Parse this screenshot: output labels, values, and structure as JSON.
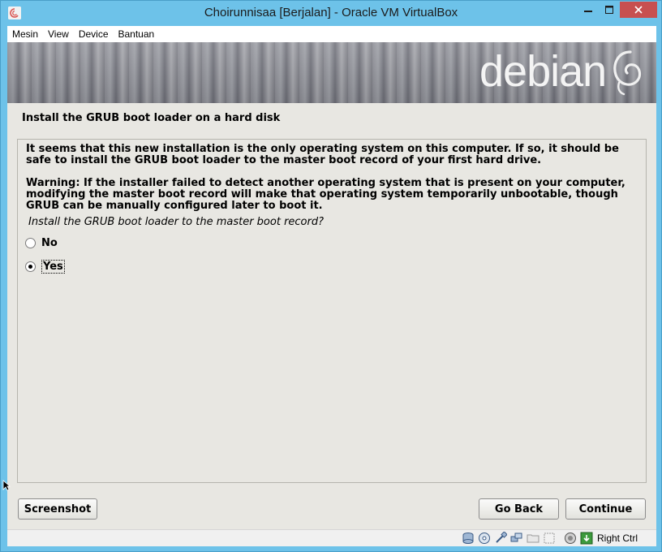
{
  "window": {
    "title": "Choirunnisaa [Berjalan] - Oracle VM VirtualBox",
    "minimize_glyph": "—",
    "maximize_glyph": "☐",
    "close_glyph": "✕"
  },
  "menu": {
    "items": [
      "Mesin",
      "View",
      "Device",
      "Bantuan"
    ]
  },
  "installer": {
    "banner_logo": "debian",
    "heading": "Install the GRUB boot loader on a hard disk",
    "paragraph1": "It seems that this new installation is the only operating system on this computer. If so, it should be safe to install the GRUB boot loader to the master boot record of your first hard drive.",
    "paragraph2": "Warning: If the installer failed to detect another operating system that is present on your computer, modifying the master boot record will make that operating system temporarily unbootable, though GRUB can be manually configured later to boot it.",
    "question": "Install the GRUB boot loader to the master boot record?",
    "options": [
      {
        "label": "No",
        "selected": false
      },
      {
        "label": "Yes",
        "selected": true
      }
    ],
    "buttons": {
      "screenshot": "Screenshot",
      "go_back": "Go Back",
      "continue": "Continue"
    }
  },
  "statusbar": {
    "icons": [
      "hard-disk-icon",
      "optical-drive-icon",
      "usb-icon",
      "network-icon",
      "shared-folder-icon",
      "display-icon",
      "video-capture-icon",
      "mouse-integration-icon",
      "keyboard-capture-icon"
    ],
    "host_key": "Right Ctrl"
  },
  "colors": {
    "titlebar": "#6dc2e9",
    "close_button": "#c75050",
    "installer_background": "#e8e7e2"
  }
}
